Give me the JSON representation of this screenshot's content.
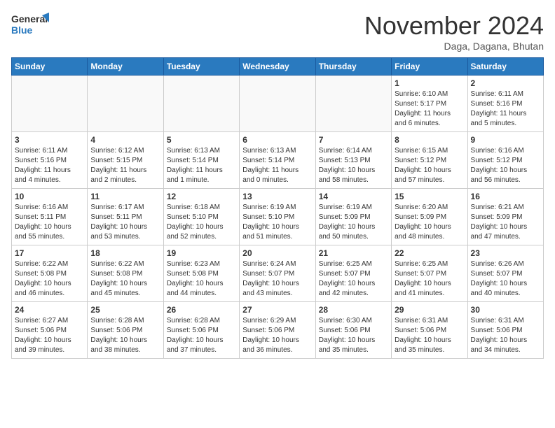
{
  "logo": {
    "line1": "General",
    "line2": "Blue"
  },
  "header": {
    "month": "November 2024",
    "location": "Daga, Dagana, Bhutan"
  },
  "weekdays": [
    "Sunday",
    "Monday",
    "Tuesday",
    "Wednesday",
    "Thursday",
    "Friday",
    "Saturday"
  ],
  "weeks": [
    [
      {
        "day": "",
        "info": ""
      },
      {
        "day": "",
        "info": ""
      },
      {
        "day": "",
        "info": ""
      },
      {
        "day": "",
        "info": ""
      },
      {
        "day": "",
        "info": ""
      },
      {
        "day": "1",
        "info": "Sunrise: 6:10 AM\nSunset: 5:17 PM\nDaylight: 11 hours\nand 6 minutes."
      },
      {
        "day": "2",
        "info": "Sunrise: 6:11 AM\nSunset: 5:16 PM\nDaylight: 11 hours\nand 5 minutes."
      }
    ],
    [
      {
        "day": "3",
        "info": "Sunrise: 6:11 AM\nSunset: 5:16 PM\nDaylight: 11 hours\nand 4 minutes."
      },
      {
        "day": "4",
        "info": "Sunrise: 6:12 AM\nSunset: 5:15 PM\nDaylight: 11 hours\nand 2 minutes."
      },
      {
        "day": "5",
        "info": "Sunrise: 6:13 AM\nSunset: 5:14 PM\nDaylight: 11 hours\nand 1 minute."
      },
      {
        "day": "6",
        "info": "Sunrise: 6:13 AM\nSunset: 5:14 PM\nDaylight: 11 hours\nand 0 minutes."
      },
      {
        "day": "7",
        "info": "Sunrise: 6:14 AM\nSunset: 5:13 PM\nDaylight: 10 hours\nand 58 minutes."
      },
      {
        "day": "8",
        "info": "Sunrise: 6:15 AM\nSunset: 5:12 PM\nDaylight: 10 hours\nand 57 minutes."
      },
      {
        "day": "9",
        "info": "Sunrise: 6:16 AM\nSunset: 5:12 PM\nDaylight: 10 hours\nand 56 minutes."
      }
    ],
    [
      {
        "day": "10",
        "info": "Sunrise: 6:16 AM\nSunset: 5:11 PM\nDaylight: 10 hours\nand 55 minutes."
      },
      {
        "day": "11",
        "info": "Sunrise: 6:17 AM\nSunset: 5:11 PM\nDaylight: 10 hours\nand 53 minutes."
      },
      {
        "day": "12",
        "info": "Sunrise: 6:18 AM\nSunset: 5:10 PM\nDaylight: 10 hours\nand 52 minutes."
      },
      {
        "day": "13",
        "info": "Sunrise: 6:19 AM\nSunset: 5:10 PM\nDaylight: 10 hours\nand 51 minutes."
      },
      {
        "day": "14",
        "info": "Sunrise: 6:19 AM\nSunset: 5:09 PM\nDaylight: 10 hours\nand 50 minutes."
      },
      {
        "day": "15",
        "info": "Sunrise: 6:20 AM\nSunset: 5:09 PM\nDaylight: 10 hours\nand 48 minutes."
      },
      {
        "day": "16",
        "info": "Sunrise: 6:21 AM\nSunset: 5:09 PM\nDaylight: 10 hours\nand 47 minutes."
      }
    ],
    [
      {
        "day": "17",
        "info": "Sunrise: 6:22 AM\nSunset: 5:08 PM\nDaylight: 10 hours\nand 46 minutes."
      },
      {
        "day": "18",
        "info": "Sunrise: 6:22 AM\nSunset: 5:08 PM\nDaylight: 10 hours\nand 45 minutes."
      },
      {
        "day": "19",
        "info": "Sunrise: 6:23 AM\nSunset: 5:08 PM\nDaylight: 10 hours\nand 44 minutes."
      },
      {
        "day": "20",
        "info": "Sunrise: 6:24 AM\nSunset: 5:07 PM\nDaylight: 10 hours\nand 43 minutes."
      },
      {
        "day": "21",
        "info": "Sunrise: 6:25 AM\nSunset: 5:07 PM\nDaylight: 10 hours\nand 42 minutes."
      },
      {
        "day": "22",
        "info": "Sunrise: 6:25 AM\nSunset: 5:07 PM\nDaylight: 10 hours\nand 41 minutes."
      },
      {
        "day": "23",
        "info": "Sunrise: 6:26 AM\nSunset: 5:07 PM\nDaylight: 10 hours\nand 40 minutes."
      }
    ],
    [
      {
        "day": "24",
        "info": "Sunrise: 6:27 AM\nSunset: 5:06 PM\nDaylight: 10 hours\nand 39 minutes."
      },
      {
        "day": "25",
        "info": "Sunrise: 6:28 AM\nSunset: 5:06 PM\nDaylight: 10 hours\nand 38 minutes."
      },
      {
        "day": "26",
        "info": "Sunrise: 6:28 AM\nSunset: 5:06 PM\nDaylight: 10 hours\nand 37 minutes."
      },
      {
        "day": "27",
        "info": "Sunrise: 6:29 AM\nSunset: 5:06 PM\nDaylight: 10 hours\nand 36 minutes."
      },
      {
        "day": "28",
        "info": "Sunrise: 6:30 AM\nSunset: 5:06 PM\nDaylight: 10 hours\nand 35 minutes."
      },
      {
        "day": "29",
        "info": "Sunrise: 6:31 AM\nSunset: 5:06 PM\nDaylight: 10 hours\nand 35 minutes."
      },
      {
        "day": "30",
        "info": "Sunrise: 6:31 AM\nSunset: 5:06 PM\nDaylight: 10 hours\nand 34 minutes."
      }
    ]
  ]
}
